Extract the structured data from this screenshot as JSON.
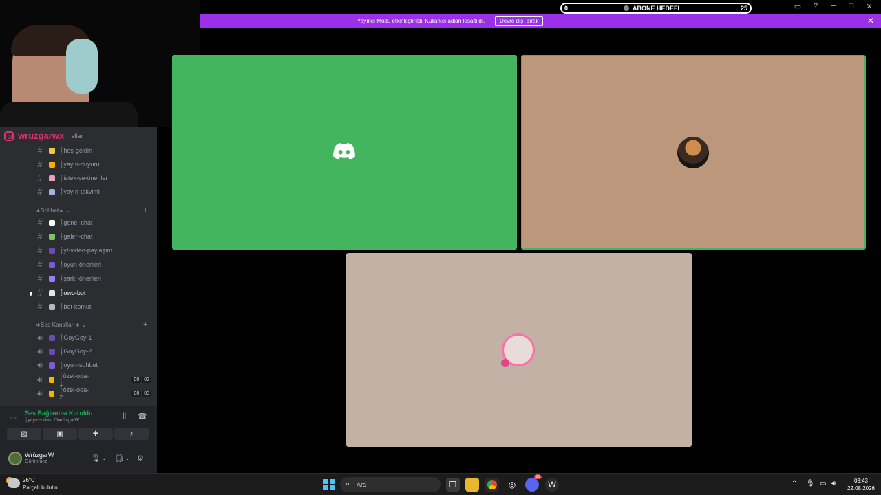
{
  "titlebar": {
    "goal": {
      "min": "0",
      "max": "25",
      "title": "ABONE HEDEFİ",
      "progress": 0
    },
    "controls": [
      "inbox-icon",
      "help-icon",
      "minimize-icon",
      "maximize-icon",
      "close-icon"
    ]
  },
  "banner": {
    "text": "Yayıncı Modu etkinleştirildi. Kullanıcı adları kısaltıldı.",
    "button": "Devre dışı bırak",
    "close": "✕"
  },
  "overlay": {
    "handle": "wruzgarwx",
    "partial_label": "allar"
  },
  "sidebar": {
    "top_channels": [
      {
        "name": "┊hoş-geldin",
        "emoji_color": "#f4c542"
      },
      {
        "name": "┊yayın-duyuru",
        "emoji_color": "#f4b400"
      },
      {
        "name": "┊istek-ve-öneriler",
        "emoji_color": "#e8a0c0"
      },
      {
        "name": "┊yayın-takvimi",
        "emoji_color": "#9fb4d8"
      }
    ],
    "chat_category": "∗Sohbet∗",
    "chat_channels": [
      {
        "name": "┊genel-chat",
        "emoji_color": "#ffffff"
      },
      {
        "name": "┊galeri-chat",
        "emoji_color": "#7cc46a"
      },
      {
        "name": "┊yt-video-paylaşım",
        "emoji_color": "#6a4bb5"
      },
      {
        "name": "┊oyun-önerileri",
        "emoji_color": "#7b5bd6"
      },
      {
        "name": "┊şarkı-önerileri",
        "emoji_color": "#9a7bff"
      },
      {
        "name": "┊owo-bot",
        "emoji_color": "#e6e6e6",
        "active": true
      },
      {
        "name": "┊bot-komut",
        "emoji_color": "#b5bac1"
      }
    ],
    "voice_category": "∗Ses Kanalları∗",
    "voice_channels": [
      {
        "name": "┊GoyGoy-1",
        "emoji_color": "#6a4bb5"
      },
      {
        "name": "┊GoyGoy-2",
        "emoji_color": "#6a4bb5"
      },
      {
        "name": "┊oyun-sohbet",
        "emoji_color": "#7b5bd6"
      },
      {
        "name": "┊özel-oda-1",
        "emoji_color": "#f4b400",
        "badges": [
          "00",
          "02"
        ]
      },
      {
        "name": "┊özel-oda-2",
        "emoji_color": "#f4b400",
        "badges": [
          "00",
          "03"
        ]
      }
    ]
  },
  "voice_panel": {
    "title": "Ses Bağlantısı Kuruldu",
    "subtitle": "┊yayın-odası / WrüzgarW",
    "actions": [
      "camera-off-icon",
      "screen-share-icon",
      "activities-icon",
      "soundboard-icon"
    ]
  },
  "user_panel": {
    "name": "WrüzgarW",
    "status": "Görünmez"
  },
  "stage": {
    "tiles": [
      {
        "name": "discord-tile",
        "color": "#43b55e"
      },
      {
        "name": "user-tile",
        "color": "#bd977b"
      },
      {
        "name": "pink-user-tile",
        "color": "#c4b1a6"
      }
    ]
  },
  "taskbar": {
    "temperature": "26°C",
    "condition": "Parçalı bulutlu",
    "search_placeholder": "Ara",
    "time": "03:43",
    "date": "22.08.2026",
    "discord_badge": "99"
  }
}
